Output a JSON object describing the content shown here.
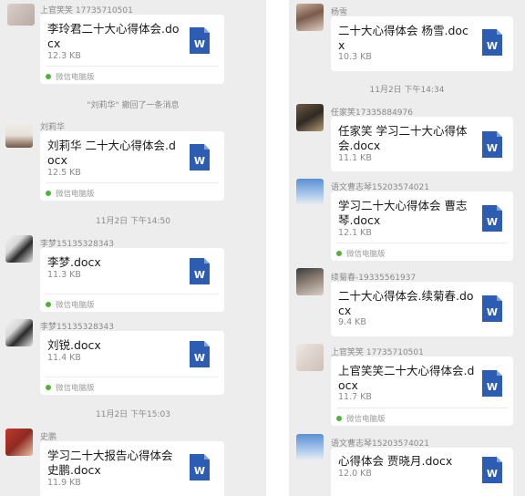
{
  "app_source_label": "微信电脑版",
  "file_icon_letter": "W",
  "colors": {
    "background": "#ededed",
    "card": "#ffffff",
    "word_blue": "#2d5db3",
    "pc_dot": "#4fb33a"
  },
  "left_column": {
    "top_message": {
      "sender": "上官笑笑 17735710501",
      "file_name": "李玲君二十大心得体会.docx",
      "size": "12.3 KB"
    },
    "recall_notice": "\"刘莉华\" 撤回了一条消息",
    "msg_liulihua": {
      "sender": "刘莉华",
      "file_name": "刘莉华 二十大心得体会.docx",
      "size": "12.5 KB"
    },
    "time_1": "11月2日 下午14:50",
    "msg_limeng_1": {
      "sender": "李梦15135328343",
      "file_name": "李梦.docx",
      "size": "11.3 KB"
    },
    "msg_limeng_2": {
      "sender": "李梦15135328343",
      "file_name": "刘锐.docx",
      "size": "11.4 KB"
    },
    "time_2": "11月2日 下午15:03",
    "msg_shipeng": {
      "sender": "史鹏",
      "file_name": "学习二十大报告心得体会史鹏.docx",
      "size": "11.9 KB"
    }
  },
  "right_column": {
    "msg_yangxue": {
      "sender": "杨雪",
      "file_name": "二十大心得体会 杨雪.docx",
      "size": "10.3 KB"
    },
    "time_1": "11月2日 下午14:34",
    "msg_renjiaxiao": {
      "sender": "任家笑17335884976",
      "file_name": "任家笑 学习二十大心得体会.docx",
      "size": "11.1 KB"
    },
    "msg_caozhiqin": {
      "sender": "语文曹志琴15203574021",
      "file_name": "学习二十大心得体会 曹志琴.docx",
      "size": "12.1 KB"
    },
    "msg_xujuchun": {
      "sender": "续菊春-19335561937",
      "file_name": "二十大心得体会.续菊春.docx",
      "size": "9.4 KB"
    },
    "msg_shangguan": {
      "sender": "上官笑笑 17735710501",
      "file_name": "上官笑笑二十大心得体会.docx",
      "size": "11.7 KB"
    },
    "msg_caozhiqin_2": {
      "sender": "语文曹志琴15203574021",
      "file_name": "心得体会 贾晓月.docx",
      "size": "12.0 KB"
    }
  }
}
